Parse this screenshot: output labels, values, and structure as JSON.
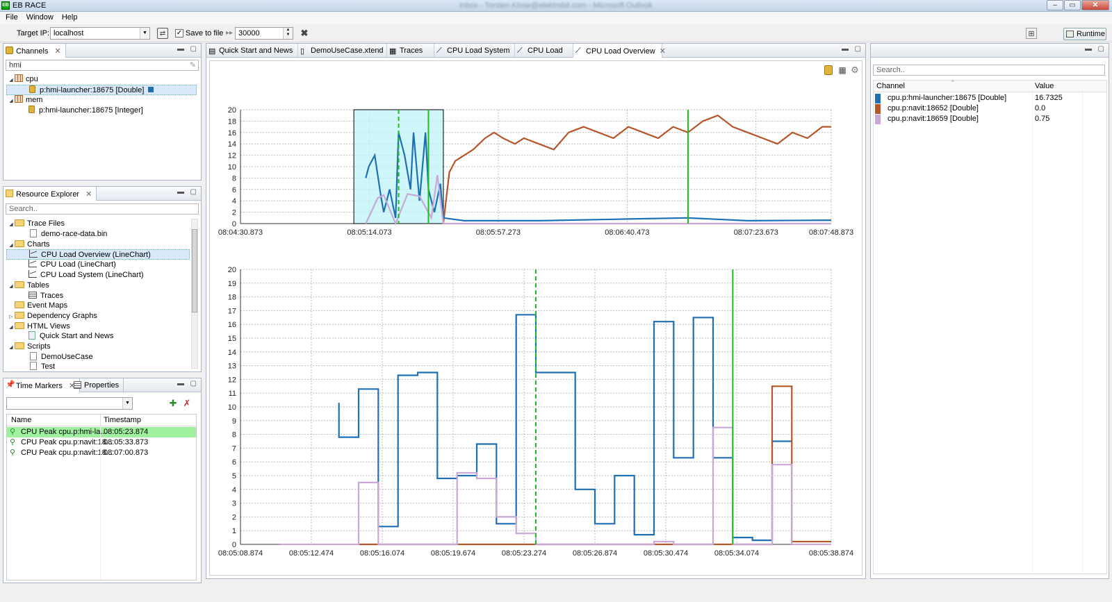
{
  "app": {
    "title": "EB RACE",
    "blurred_title": "Inbox - Torsten.Klose@elektrobit.com - Microsoft Outlook"
  },
  "menu": [
    "File",
    "Window",
    "Help"
  ],
  "toolbar": {
    "target_ip_label": "Target IP:",
    "target_ip_value": "localhost",
    "save_to_file_label": "Save to file",
    "save_to_file_checked": true,
    "buffer_value": "30000",
    "runtime_label": "Runtime"
  },
  "channels_panel": {
    "tab": "Channels",
    "filter": "hmi",
    "tree": [
      {
        "label": "cpu",
        "level": 0,
        "kind": "group"
      },
      {
        "label": "p:hmi-launcher:18675 [Double]",
        "level": 1,
        "kind": "channel",
        "selected": true,
        "color": "#1f6fb4"
      },
      {
        "label": "mem",
        "level": 0,
        "kind": "group"
      },
      {
        "label": "p:hmi-launcher:18675 [Integer]",
        "level": 1,
        "kind": "channel"
      }
    ]
  },
  "resource_panel": {
    "tab": "Resource Explorer",
    "search_placeholder": "Search..",
    "tree": [
      {
        "label": "Trace Files",
        "level": 0,
        "kind": "folder"
      },
      {
        "label": "demo-race-data.bin",
        "level": 1,
        "kind": "file"
      },
      {
        "label": "Charts",
        "level": 0,
        "kind": "folder"
      },
      {
        "label": "CPU Load Overview (LineChart)",
        "level": 1,
        "kind": "chart",
        "selected": true
      },
      {
        "label": "CPU Load (LineChart)",
        "level": 1,
        "kind": "chart"
      },
      {
        "label": "CPU Load System (LineChart)",
        "level": 1,
        "kind": "chart"
      },
      {
        "label": "Tables",
        "level": 0,
        "kind": "folder"
      },
      {
        "label": "Traces",
        "level": 1,
        "kind": "table"
      },
      {
        "label": "Event Maps",
        "level": 0,
        "kind": "folder"
      },
      {
        "label": "Dependency Graphs",
        "level": 0,
        "kind": "folder"
      },
      {
        "label": "HTML Views",
        "level": 0,
        "kind": "folder"
      },
      {
        "label": "Quick Start and News",
        "level": 1,
        "kind": "script"
      },
      {
        "label": "Scripts",
        "level": 0,
        "kind": "folder"
      },
      {
        "label": "DemoUseCase",
        "level": 1,
        "kind": "file"
      },
      {
        "label": "Test",
        "level": 1,
        "kind": "file"
      }
    ]
  },
  "markers_panel": {
    "tabs": [
      "Time Markers",
      "Properties"
    ],
    "columns": [
      "Name",
      "Timestamp"
    ],
    "rows": [
      {
        "name": "CPU Peak cpu.p:hmi-la...",
        "timestamp": "08:05:23.874",
        "selected": true
      },
      {
        "name": "CPU Peak cpu.p:navit:18...",
        "timestamp": "08:05:33.873"
      },
      {
        "name": "CPU Peak cpu.p:navit:18...",
        "timestamp": "08:07:00.873"
      }
    ]
  },
  "editor_tabs": [
    "Quick Start and News",
    "DemoUseCase.xtend",
    "Traces",
    "CPU Load System",
    "CPU Load",
    "CPU Load Overview"
  ],
  "legend_panel": {
    "search_placeholder": "Search..",
    "columns": [
      "Channel",
      "Value"
    ],
    "rows": [
      {
        "channel": "cpu.p:hmi-launcher:18675 [Double]",
        "value": "16.7325",
        "color": "#1f6fb4"
      },
      {
        "channel": "cpu.p:navit:18652 [Double]",
        "value": "0.0",
        "color": "#b5552a"
      },
      {
        "channel": "cpu.p:navit:18659 [Double]",
        "value": "0.75",
        "color": "#c9a8d8"
      }
    ]
  },
  "colors": {
    "blue": "#1f6fb4",
    "orange": "#b5552a",
    "lilac": "#c9a8d8",
    "marker": "#22bb22",
    "highlight": "#9ff09f"
  },
  "chart_data": [
    {
      "type": "line",
      "name": "overview",
      "ylim": [
        0,
        20
      ],
      "yticks": [
        0,
        2,
        4,
        6,
        8,
        10,
        12,
        14,
        16,
        18,
        20
      ],
      "xlim_seconds": [
        0,
        198
      ],
      "xtick_labels": [
        "08:04:30.873",
        "08:05:14.073",
        "08:05:57.273",
        "08:06:40.473",
        "08:07:23.673",
        "08:07:48.873"
      ],
      "xtick_seconds": [
        0,
        43.2,
        86.4,
        129.6,
        172.8,
        198
      ],
      "selection_seconds": [
        38,
        68
      ],
      "markers": [
        {
          "t": 53,
          "style": "dashed"
        },
        {
          "t": 63,
          "style": "solid"
        },
        {
          "t": 150,
          "style": "solid"
        }
      ],
      "series": [
        {
          "name": "cpu.p:navit:18652 [Double]",
          "color": "#b5552a",
          "x": [
            68,
            70,
            72,
            75,
            78,
            80,
            82,
            85,
            88,
            92,
            95,
            100,
            105,
            110,
            115,
            120,
            125,
            130,
            135,
            140,
            145,
            150,
            155,
            160,
            165,
            170,
            175,
            180,
            185,
            190,
            195,
            198
          ],
          "y": [
            0,
            9,
            11,
            12,
            13,
            14,
            15,
            16,
            15,
            14,
            15,
            14,
            13,
            16,
            17,
            16,
            15,
            17,
            16,
            15,
            17,
            16,
            18,
            19,
            17,
            16,
            15,
            14,
            16,
            15,
            17,
            17
          ]
        },
        {
          "name": "cpu.p:hmi-launcher:18675 [Double]",
          "color": "#1f6fb4",
          "x": [
            42,
            43,
            45,
            47,
            48,
            50,
            52,
            53,
            55,
            57,
            58,
            60,
            62,
            63,
            65,
            67,
            68,
            75,
            100,
            130,
            150,
            170,
            198
          ],
          "y": [
            8,
            10,
            12,
            5,
            2,
            6,
            1,
            16,
            12,
            6,
            16,
            4,
            16,
            6,
            2,
            7,
            1,
            0.5,
            0.5,
            0.8,
            1,
            0.5,
            0.6
          ]
        },
        {
          "name": "cpu.p:navit:18659 [Double]",
          "color": "#c9a8d8",
          "x": [
            42,
            46,
            48,
            52,
            56,
            60,
            64,
            66,
            68,
            80,
            198
          ],
          "y": [
            0,
            4.5,
            5,
            0,
            5.2,
            4.8,
            1,
            8.5,
            0,
            0,
            0
          ]
        }
      ]
    },
    {
      "type": "line",
      "name": "detail",
      "ylim": [
        0,
        20
      ],
      "yticks": [
        0,
        1,
        2,
        3,
        4,
        5,
        6,
        7,
        8,
        9,
        10,
        11,
        12,
        13,
        14,
        15,
        16,
        17,
        18,
        19,
        20
      ],
      "xlim_seconds": [
        0,
        30
      ],
      "xtick_labels": [
        "08:05:08.874",
        "08:05:12.474",
        "08:05:16.074",
        "08:05:19.674",
        "08:05:23.274",
        "08:05:26.874",
        "08:05:30.474",
        "08:05:34.074",
        "08:05:38.874"
      ],
      "xtick_seconds": [
        0,
        3.6,
        7.2,
        10.8,
        14.4,
        18,
        21.6,
        25.2,
        30
      ],
      "markers": [
        {
          "t": 15,
          "style": "dashed"
        },
        {
          "t": 25,
          "style": "solid"
        }
      ],
      "series": [
        {
          "name": "cpu.p:hmi-launcher:18675 [Double]",
          "color": "#1f6fb4",
          "x": [
            5,
            5,
            6,
            6,
            7,
            7,
            8,
            8,
            9,
            9,
            10,
            10,
            11,
            11,
            12,
            12,
            13,
            13,
            14,
            14,
            15,
            15,
            16,
            16,
            17,
            17,
            18,
            18,
            19,
            19,
            20,
            20,
            21,
            21,
            22,
            22,
            23,
            23,
            24,
            24,
            25,
            25,
            26,
            26,
            27,
            27,
            28
          ],
          "y": [
            10.3,
            7.8,
            7.8,
            11.3,
            11.3,
            1.3,
            1.3,
            12.3,
            12.3,
            12.5,
            12.5,
            4.8,
            4.8,
            5,
            5,
            7.3,
            7.3,
            1.5,
            1.5,
            16.7,
            16.7,
            12.5,
            12.5,
            12.5,
            12.5,
            4,
            4,
            1.5,
            1.5,
            5,
            5,
            0.7,
            0.7,
            16.2,
            16.2,
            6.3,
            6.3,
            16.5,
            16.5,
            6.3,
            6.3,
            0.5,
            0.5,
            0.3,
            0.3,
            7.5,
            7.5
          ]
        },
        {
          "name": "cpu.p:navit:18652 [Double]",
          "color": "#b5552a",
          "x": [
            6,
            6,
            7,
            11,
            14,
            15,
            24,
            25,
            26,
            26,
            27,
            27,
            28,
            28,
            30
          ],
          "y": [
            0,
            0,
            0,
            0,
            0,
            0,
            0,
            0,
            0,
            0,
            0,
            11.5,
            11.5,
            0.2,
            0.2
          ]
        },
        {
          "name": "cpu.p:navit:18659 [Double]",
          "color": "#c9a8d8",
          "x": [
            2,
            6,
            6,
            7,
            7,
            11,
            11,
            12,
            12,
            13,
            13,
            14,
            14,
            15,
            15,
            21,
            21,
            22,
            22,
            24,
            24,
            25,
            25,
            27,
            27,
            28,
            28,
            30
          ],
          "y": [
            0,
            0,
            4.5,
            4.5,
            0,
            0,
            5.2,
            5.2,
            4.8,
            4.8,
            2,
            2,
            0.8,
            0.8,
            0,
            0,
            0.2,
            0.2,
            0,
            0,
            8.5,
            8.5,
            0,
            0,
            5.8,
            5.8,
            0,
            0
          ]
        }
      ]
    }
  ]
}
